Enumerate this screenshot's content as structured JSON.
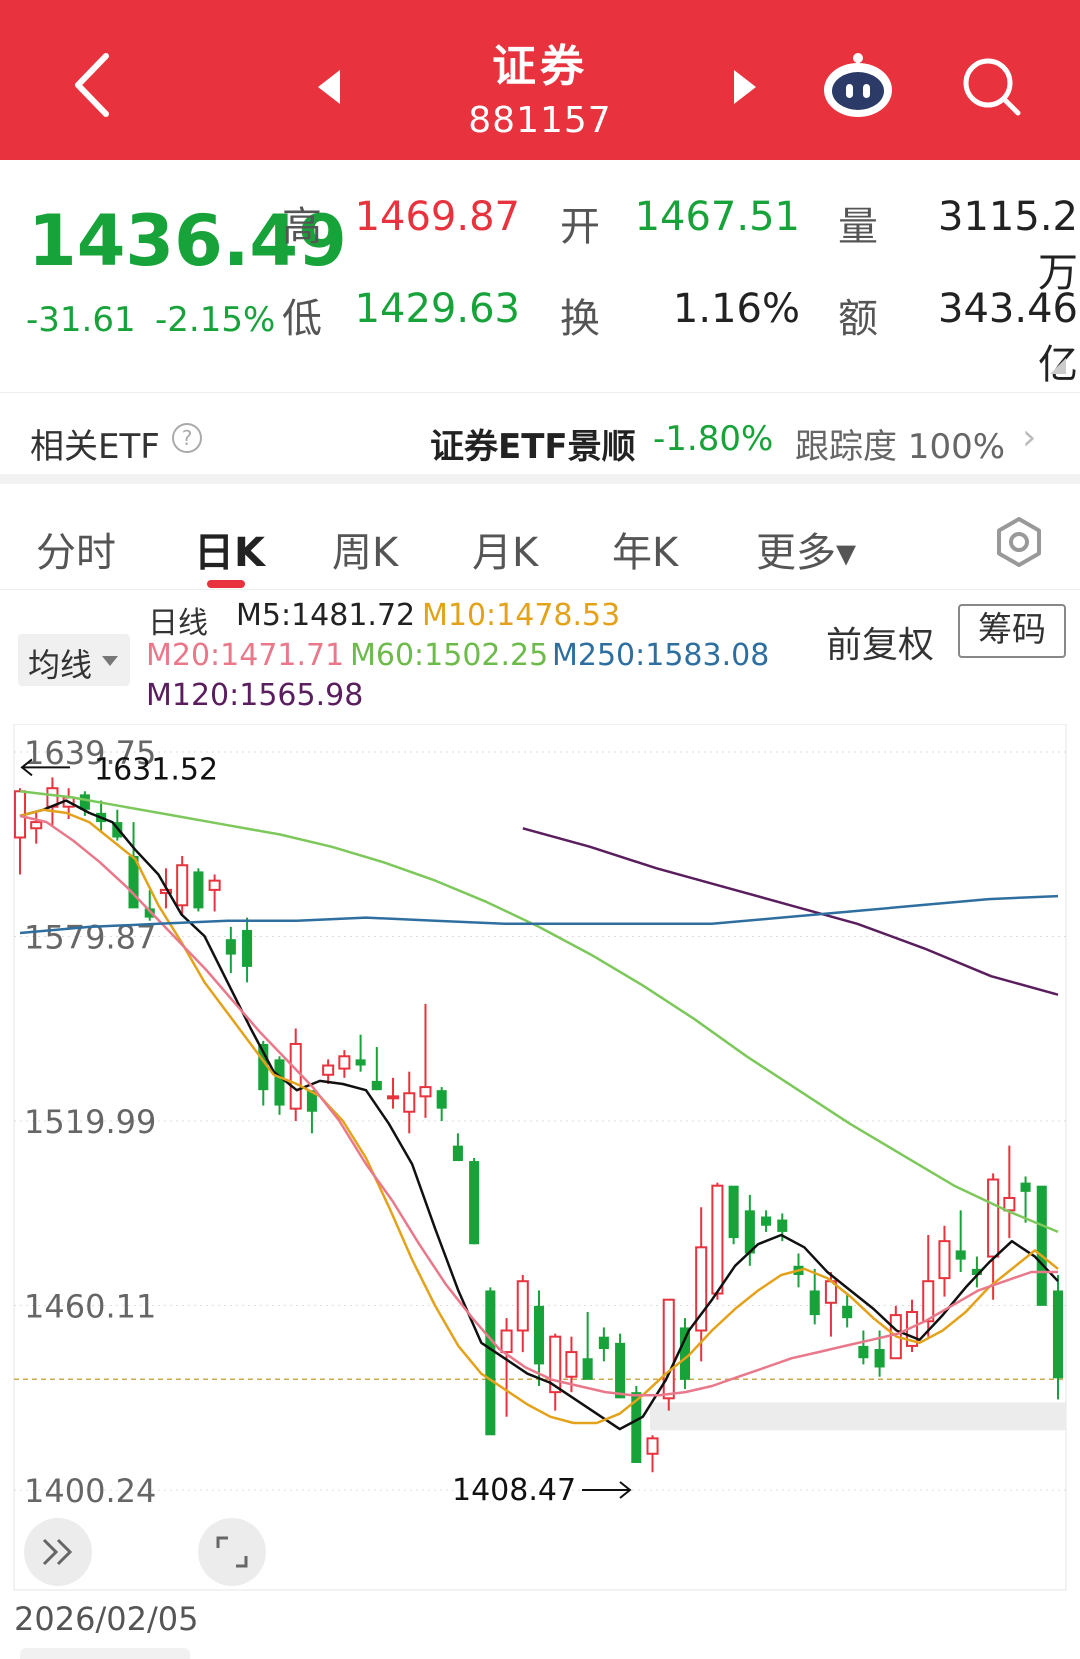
{
  "header": {
    "title": "证券",
    "code": "881157"
  },
  "quote": {
    "price": "1436.49",
    "change": "-31.61",
    "change_pct": "-2.15%",
    "high_label": "高",
    "high": "1469.87",
    "open_label": "开",
    "open": "1467.51",
    "volume_label": "量",
    "volume": "3115.2万",
    "low_label": "低",
    "low": "1429.63",
    "turnover_label": "换",
    "turnover": "1.16%",
    "amount_label": "额",
    "amount": "343.46亿"
  },
  "etf": {
    "label": "相关ETF",
    "help": "?",
    "name": "证券ETF景顺",
    "pct": "-1.80%",
    "track": "跟踪度 100%",
    "chevron": "›"
  },
  "tabs": [
    {
      "label": "分时"
    },
    {
      "label": "日K"
    },
    {
      "label": "周K"
    },
    {
      "label": "月K"
    },
    {
      "label": "年K"
    },
    {
      "label": "更多▾"
    }
  ],
  "legend": {
    "ma_button": "均线",
    "period": "日线",
    "m5": "M5:1481.72",
    "m10": "M10:1478.53",
    "m20": "M20:1471.71",
    "m60": "M60:1502.25",
    "m250": "M250:1583.08",
    "m120": "M120:1565.98",
    "fuquan": "前复权",
    "chouma": "筹码"
  },
  "colors": {
    "up": "#e8323d",
    "down": "#18a33a",
    "m5": "#111111",
    "m10": "#e3a21a",
    "m20": "#e8788a",
    "m60": "#7cc85a",
    "m120": "#5a1e5e",
    "m250": "#2e6fa0"
  },
  "chart_data": {
    "type": "candlestick",
    "y_ticks": [
      "1639.75",
      "1579.87",
      "1519.99",
      "1460.11",
      "1400.24"
    ],
    "ylim": [
      1400.24,
      1639.75
    ],
    "max_marker": "1631.52",
    "min_marker": "1408.47",
    "date_label": "2026/02/05",
    "candles": [
      [
        1612,
        1628,
        1600,
        1627
      ],
      [
        1615,
        1620,
        1610,
        1617
      ],
      [
        1622,
        1631.52,
        1616,
        1628
      ],
      [
        1622,
        1628,
        1618,
        1625
      ],
      [
        1626,
        1627,
        1619,
        1621
      ],
      [
        1620,
        1624,
        1614,
        1617
      ],
      [
        1617,
        1621,
        1611,
        1612
      ],
      [
        1606,
        1617,
        1590,
        1589
      ],
      [
        1589,
        1595,
        1585,
        1586
      ],
      [
        1594,
        1602,
        1589,
        1595
      ],
      [
        1590,
        1606,
        1587,
        1603
      ],
      [
        1601,
        1602,
        1588,
        1589
      ],
      [
        1595,
        1600,
        1588,
        1598
      ],
      [
        1579,
        1583,
        1568,
        1574
      ],
      [
        1582,
        1586,
        1565,
        1570
      ],
      [
        1545,
        1546,
        1525,
        1530
      ],
      [
        1540,
        1541,
        1522,
        1525
      ],
      [
        1524,
        1550,
        1520,
        1545
      ],
      [
        1530,
        1528,
        1516,
        1523
      ],
      [
        1535,
        1540,
        1532,
        1538
      ],
      [
        1537,
        1543,
        1534,
        1541
      ],
      [
        1540,
        1548,
        1536,
        1538
      ],
      [
        1533,
        1544,
        1530,
        1530
      ],
      [
        1528,
        1534,
        1524,
        1528
      ],
      [
        1523,
        1536,
        1516,
        1529
      ],
      [
        1528,
        1558,
        1521,
        1531
      ],
      [
        1530,
        1531,
        1520,
        1524
      ],
      [
        1512,
        1516,
        1507,
        1507
      ],
      [
        1507,
        1508,
        1480,
        1480
      ],
      [
        1465,
        1466,
        1421,
        1418
      ],
      [
        1445,
        1456,
        1424,
        1452
      ],
      [
        1452,
        1470,
        1445,
        1468
      ],
      [
        1460,
        1465,
        1434,
        1441
      ],
      [
        1432,
        1451,
        1426,
        1450
      ],
      [
        1437,
        1450,
        1432,
        1445
      ],
      [
        1443,
        1458,
        1437,
        1436
      ],
      [
        1450,
        1453,
        1442,
        1446
      ],
      [
        1448,
        1451,
        1430,
        1430
      ],
      [
        1432,
        1434,
        1410,
        1409
      ],
      [
        1412,
        1418,
        1406,
        1417
      ],
      [
        1430,
        1462,
        1426,
        1462
      ],
      [
        1453,
        1456,
        1433,
        1436
      ],
      [
        1452,
        1492,
        1442,
        1479
      ],
      [
        1464,
        1500,
        1462,
        1499
      ],
      [
        1499,
        1490,
        1480,
        1482
      ],
      [
        1491,
        1496,
        1473,
        1477
      ],
      [
        1489,
        1491,
        1484,
        1486
      ],
      [
        1488,
        1490,
        1481,
        1484
      ],
      [
        1473,
        1477,
        1466,
        1470
      ],
      [
        1465,
        1472,
        1454,
        1457
      ],
      [
        1461,
        1471,
        1450,
        1468
      ],
      [
        1460,
        1464,
        1453,
        1456
      ],
      [
        1447,
        1452,
        1441,
        1443
      ],
      [
        1446,
        1452,
        1437,
        1440
      ],
      [
        1443,
        1460,
        1443,
        1457
      ],
      [
        1447,
        1462,
        1445,
        1458
      ],
      [
        1455,
        1483,
        1450,
        1468
      ],
      [
        1469,
        1486,
        1463,
        1481
      ],
      [
        1478,
        1491,
        1471,
        1475
      ],
      [
        1472,
        1476,
        1466,
        1470
      ],
      [
        1476,
        1503,
        1462,
        1501
      ],
      [
        1491,
        1512,
        1482,
        1495
      ],
      [
        1500,
        1502,
        1487,
        1497
      ],
      [
        1499,
        1495,
        1461,
        1460
      ],
      [
        1465,
        1470,
        1429.63,
        1436.49
      ]
    ],
    "series": [
      {
        "name": "M5",
        "values": [
          1619,
          1621,
          1624,
          1620,
          1617,
          1608,
          1600,
          1587,
          1580,
          1565,
          1550,
          1536,
          1530,
          1533,
          1532,
          1530,
          1519,
          1506,
          1485,
          1465,
          1448,
          1443,
          1438,
          1435,
          1430,
          1425,
          1420,
          1424,
          1436,
          1452,
          1462,
          1473,
          1480,
          1483,
          1479,
          1471,
          1465,
          1459,
          1452,
          1449,
          1457,
          1466,
          1474,
          1481,
          1476,
          1468
        ]
      },
      {
        "name": "M10",
        "values": [
          1619,
          1621,
          1620,
          1617,
          1611,
          1605,
          1590,
          1578,
          1565,
          1555,
          1545,
          1535,
          1532,
          1528,
          1520,
          1508,
          1492,
          1475,
          1460,
          1447,
          1438,
          1433,
          1428,
          1424,
          1422,
          1422,
          1425,
          1431,
          1438,
          1444,
          1452,
          1459,
          1465,
          1470,
          1472,
          1469,
          1463,
          1456,
          1450,
          1448,
          1452,
          1458,
          1466,
          1472,
          1478,
          1472
        ]
      },
      {
        "name": "M20",
        "values": [
          1619,
          1617,
          1611,
          1604,
          1596,
          1587,
          1578,
          1569,
          1559,
          1549,
          1540,
          1531,
          1520,
          1506,
          1494,
          1480,
          1467,
          1456,
          1446,
          1440,
          1436,
          1434,
          1432,
          1431,
          1431,
          1432,
          1434,
          1437,
          1440,
          1443,
          1445,
          1447,
          1449,
          1451,
          1455,
          1460,
          1465,
          1468,
          1471,
          1471
        ]
      },
      {
        "name": "M60",
        "values": [
          1627,
          1625,
          1622,
          1619,
          1616,
          1613,
          1609,
          1604,
          1598,
          1591,
          1583,
          1574,
          1564,
          1553,
          1541,
          1530,
          1519,
          1509,
          1499,
          1491,
          1484
        ]
      },
      {
        "name": "M120",
        "values": [
          1615,
          1609,
          1602,
          1596,
          1590,
          1584,
          1576,
          1567,
          1561
        ]
      },
      {
        "name": "M250",
        "values": [
          1581,
          1583,
          1584,
          1585,
          1585,
          1586,
          1585,
          1584,
          1584,
          1584,
          1584,
          1586,
          1588,
          1590,
          1592,
          1593
        ]
      }
    ]
  }
}
